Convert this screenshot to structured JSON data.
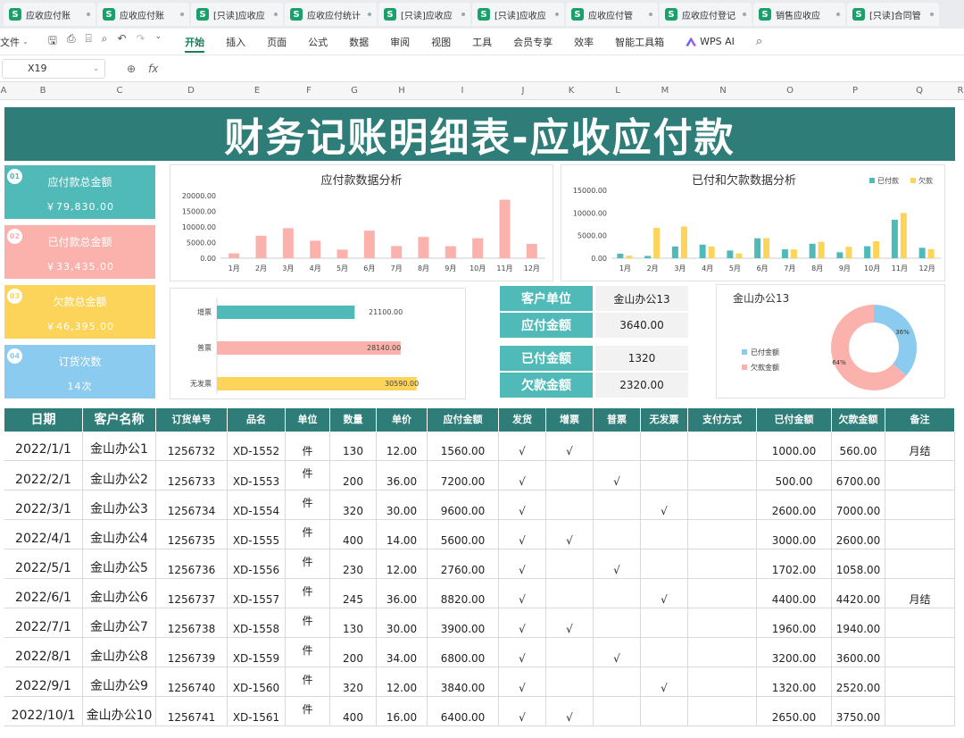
{
  "tabs": [
    {
      "label": "应收应付账"
    },
    {
      "label": "应收应付账"
    },
    {
      "label": "[只读]应收应"
    },
    {
      "label": "应收应付统计"
    },
    {
      "label": "[只读]应收应"
    },
    {
      "label": "[只读]应收应"
    },
    {
      "label": "应收应付管"
    },
    {
      "label": "应收应付登记"
    },
    {
      "label": "销售应收应"
    },
    {
      "label": "[只读]合同管"
    }
  ],
  "menu": {
    "file": "文件",
    "items": [
      "开始",
      "插入",
      "页面",
      "公式",
      "数据",
      "审阅",
      "视图",
      "工具",
      "会员专享",
      "效率",
      "智能工具箱"
    ],
    "wps_ai": "WPS AI"
  },
  "formula": {
    "cell_ref": "X19",
    "content": ""
  },
  "columns": [
    "A",
    "B",
    "C",
    "D",
    "E",
    "F",
    "G",
    "H",
    "I",
    "J",
    "K",
    "L",
    "M",
    "N",
    "O",
    "P",
    "Q",
    "R"
  ],
  "banner": "财务记账明细表-应收应付款",
  "kpis": [
    {
      "num": "01",
      "title": "应付款总金额",
      "value": "￥79,830.00",
      "color": "#4fbab8"
    },
    {
      "num": "02",
      "title": "已付款总金额",
      "value": "￥33,435.00",
      "color": "#fbb2ad"
    },
    {
      "num": "03",
      "title": "欠款总金额",
      "value": "￥46,395.00",
      "color": "#fcd45a"
    },
    {
      "num": "04",
      "title": "订货次数",
      "value": "14次",
      "color": "#8ccbf0"
    }
  ],
  "chart1": {
    "title": "应付款数据分析",
    "ticks": [
      "20000.00",
      "15000.00",
      "10000.00",
      "5000.00",
      "0.00"
    ]
  },
  "chart2": {
    "title": "已付和欠款数据分析",
    "legend": [
      "已付款",
      "欠款"
    ],
    "ticks": [
      "15000.00",
      "10000.00",
      "5000.00",
      "0.00"
    ]
  },
  "chart3": {
    "ticks": []
  },
  "chart4": {
    "title": "金山办公13",
    "legend": [
      "已付金额",
      "欠款金额"
    ],
    "labels": [
      "36%",
      "64%"
    ]
  },
  "chart_data": [
    {
      "type": "bar",
      "title": "应付款数据分析",
      "categories": [
        "1月",
        "2月",
        "3月",
        "4月",
        "5月",
        "6月",
        "7月",
        "8月",
        "9月",
        "10月",
        "11月",
        "12月"
      ],
      "values": [
        1560,
        7200,
        9600,
        5600,
        2760,
        8820,
        3900,
        6800,
        3840,
        6400,
        18700,
        4600
      ],
      "ylim": [
        0,
        20000
      ],
      "color": "#fbb2ad"
    },
    {
      "type": "bar",
      "title": "已付和欠款数据分析",
      "categories": [
        "1月",
        "2月",
        "3月",
        "4月",
        "5月",
        "6月",
        "7月",
        "8月",
        "9月",
        "10月",
        "11月",
        "12月"
      ],
      "series": [
        {
          "name": "已付款",
          "color": "#4fbab8",
          "values": [
            1000,
            500,
            2600,
            3000,
            1702,
            4400,
            1960,
            3200,
            1320,
            2650,
            8500,
            2300
          ]
        },
        {
          "name": "欠款",
          "color": "#fcd45a",
          "values": [
            560,
            6700,
            7000,
            2600,
            1058,
            4420,
            1940,
            3600,
            2520,
            3750,
            10000,
            2000
          ]
        }
      ],
      "ylim": [
        0,
        15000
      ],
      "legend": "top-right"
    },
    {
      "type": "bar",
      "orientation": "horizontal",
      "categories": [
        "增票",
        "普票",
        "无发票"
      ],
      "values": [
        21100,
        28140,
        30590
      ],
      "labels": [
        "21100.00",
        "28140.00",
        "30590.00"
      ],
      "colors": [
        "#4fbab8",
        "#fbb2ad",
        "#fcd45a"
      ],
      "xlim": [
        0,
        38000
      ]
    },
    {
      "type": "pie",
      "donut": true,
      "title": "金山办公13",
      "labels": [
        "已付金额",
        "欠款金额"
      ],
      "values": [
        1320,
        2320
      ],
      "colors": [
        "#8ccbf0",
        "#fbb2ad"
      ],
      "legend": "left"
    }
  ],
  "info": {
    "customer_label": "客户单位",
    "customer_value": "金山办公13",
    "payable_label": "应付金额",
    "payable_value": "3640.00",
    "paid_label": "已付金额",
    "paid_value": "1320",
    "owed_label": "欠款金额",
    "owed_value": "2320.00"
  },
  "table": {
    "headers": [
      "日期",
      "客户名称",
      "订货单号",
      "品名",
      "单位",
      "数量",
      "单价",
      "应付金额",
      "发货",
      "增票",
      "普票",
      "无发票",
      "支付方式",
      "已付金额",
      "欠款金额",
      "备注"
    ],
    "rows": [
      [
        "2022/1/1",
        "金山办公1",
        "1256732",
        "XD-1552",
        "件",
        "130",
        "12.00",
        "1560.00",
        "√",
        "√",
        "",
        "",
        "",
        "1000.00",
        "560.00",
        "月结"
      ],
      [
        "2022/2/1",
        "金山办公2",
        "1256733",
        "XD-1553",
        "件",
        "200",
        "36.00",
        "7200.00",
        "√",
        "",
        "√",
        "",
        "",
        "500.00",
        "6700.00",
        ""
      ],
      [
        "2022/3/1",
        "金山办公3",
        "1256734",
        "XD-1554",
        "件",
        "320",
        "30.00",
        "9600.00",
        "√",
        "",
        "",
        "√",
        "",
        "2600.00",
        "7000.00",
        ""
      ],
      [
        "2022/4/1",
        "金山办公4",
        "1256735",
        "XD-1555",
        "件",
        "400",
        "14.00",
        "5600.00",
        "√",
        "√",
        "",
        "",
        "",
        "3000.00",
        "2600.00",
        ""
      ],
      [
        "2022/5/1",
        "金山办公5",
        "1256736",
        "XD-1556",
        "件",
        "230",
        "12.00",
        "2760.00",
        "√",
        "",
        "√",
        "",
        "",
        "1702.00",
        "1058.00",
        ""
      ],
      [
        "2022/6/1",
        "金山办公6",
        "1256737",
        "XD-1557",
        "件",
        "245",
        "36.00",
        "8820.00",
        "√",
        "",
        "",
        "√",
        "",
        "4400.00",
        "4420.00",
        "月结"
      ],
      [
        "2022/7/1",
        "金山办公7",
        "1256738",
        "XD-1558",
        "件",
        "130",
        "30.00",
        "3900.00",
        "√",
        "√",
        "",
        "",
        "",
        "1960.00",
        "1940.00",
        ""
      ],
      [
        "2022/8/1",
        "金山办公8",
        "1256739",
        "XD-1559",
        "件",
        "200",
        "34.00",
        "6800.00",
        "√",
        "",
        "√",
        "",
        "",
        "3200.00",
        "3600.00",
        ""
      ],
      [
        "2022/9/1",
        "金山办公9",
        "1256740",
        "XD-1560",
        "件",
        "320",
        "12.00",
        "3840.00",
        "√",
        "",
        "",
        "√",
        "",
        "1320.00",
        "2520.00",
        ""
      ],
      [
        "2022/10/1",
        "金山办公10",
        "1256741",
        "XD-1561",
        "件",
        "400",
        "16.00",
        "6400.00",
        "√",
        "√",
        "",
        "",
        "",
        "2650.00",
        "3750.00",
        ""
      ]
    ]
  }
}
